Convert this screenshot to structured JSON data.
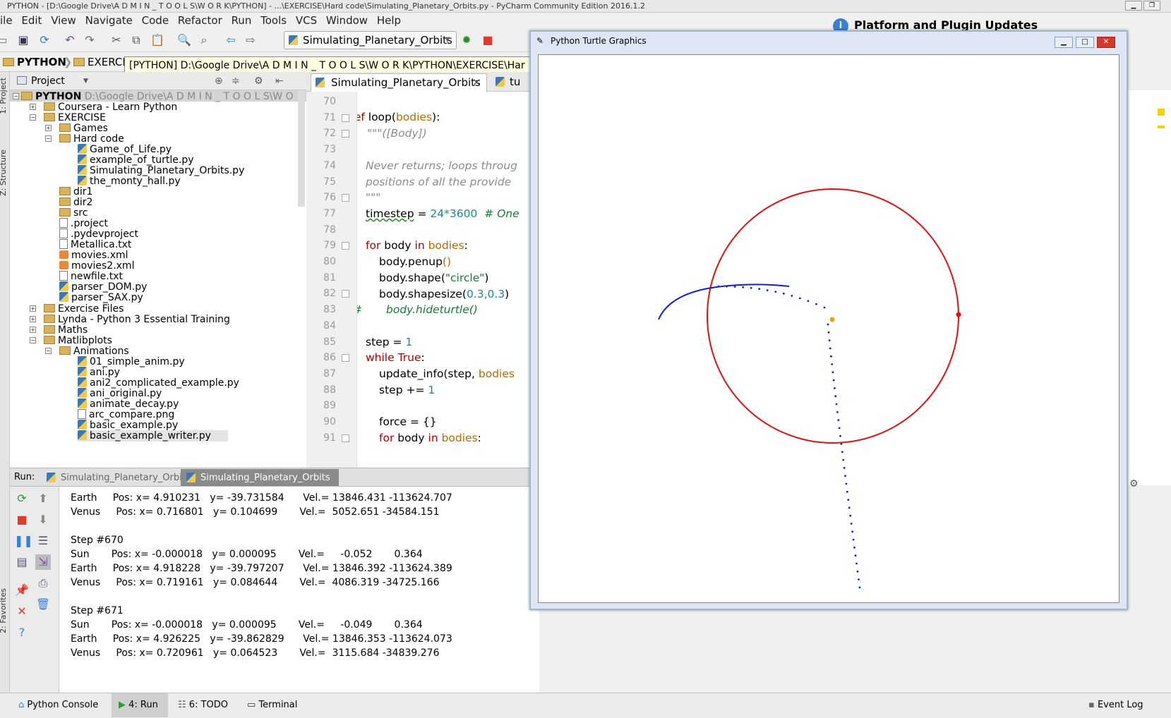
{
  "window": {
    "title": "PYTHON - [D:\\Google Drive\\A D M I N _ T O O L S\\W O R K\\PYTHON] - ...\\EXERCISE\\Hard code\\Simulating_Planetary_Orbits.py - PyCharm Community Edition 2016.1.2"
  },
  "menu": [
    "ile",
    "Edit",
    "View",
    "Navigate",
    "Code",
    "Refactor",
    "Run",
    "Tools",
    "VCS",
    "Window",
    "Help"
  ],
  "toolbar": {
    "run_config": "Simulating_Planetary_Orbits"
  },
  "navbar": {
    "crumb1": "PYTHON",
    "crumb2": "EXERCI"
  },
  "tooltip": "[PYTHON] D:\\Google Drive\\A D M I N _ T O O L S\\W O R K\\PYTHON\\EXERCISE\\Har",
  "side_tabs": {
    "project": "1: Project",
    "structure": "Z: Structure",
    "favorites": "2: Favorites"
  },
  "project": {
    "header": "Project",
    "root_name": "PYTHON",
    "root_path": "D:\\Google Drive\\A D M I N _ T O O L S\\W O",
    "items": [
      "Coursera - Learn Python",
      "EXERCISE",
      "Games",
      "Hard code",
      "Game_of_Life.py",
      "example_of_turtle.py",
      "Simulating_Planetary_Orbits.py",
      "the_monty_hall.py",
      "dir1",
      "dir2",
      "src",
      ".project",
      ".pydevproject",
      "Metallica.txt",
      "movies.xml",
      "movies2.xml",
      "newfile.txt",
      "parser_DOM.py",
      "parser_SAX.py",
      "Exercise Files",
      "Lynda - Python 3 Essential Training",
      "Maths",
      "Matlibplots",
      "Animations",
      "01_simple_anim.py",
      "ani.py",
      "ani2_complicated_example.py",
      "ani_original.py",
      "animate_decay.py",
      "arc_compare.png",
      "basic_example.py",
      "basic_example_writer.py"
    ]
  },
  "editor": {
    "tab1": "Simulating_Planetary_Orbits",
    "tab2": "tu",
    "line_numbers": [
      "70",
      "71",
      "72",
      "73",
      "74",
      "75",
      "76",
      "77",
      "78",
      "79",
      "80",
      "81",
      "82",
      "83",
      "84",
      "85",
      "86",
      "87",
      "88",
      "89",
      "90",
      "91"
    ],
    "code": {
      "l71_kw": "def ",
      "l71_fn": "loop",
      "l71_p1": "(",
      "l71_pm": "bodies",
      "l71_p2": "):",
      "l72": "\"\"\"([Body])",
      "l74": "Never returns; loops throug",
      "l75": "positions of all the provide",
      "l76": "\"\"\"",
      "l77_a": "timestep",
      "l77_b": " = ",
      "l77_n": "24*3600",
      "l77_c": "  # One",
      "l79_kw": "for",
      "l79_b": " body ",
      "l79_kw2": "in",
      "l79_pm": " bodies",
      "l79_c": ":",
      "l80_a": "body.penup",
      "l80_b": "()",
      "l81_a": "body.shape(",
      "l81_s": "\"circle\"",
      "l81_b": ")",
      "l82_a": "body.shapesize(",
      "l82_n": "0.3,0.3",
      "l82_b": ")",
      "l83_h": "#",
      "l83_c": "body.hideturtle()",
      "l85_a": "step",
      "l85_b": " = ",
      "l85_n": "1",
      "l86_kw": "while",
      "l86_kw2": " True",
      "l86_c": ":",
      "l87_a": "update_info(step, ",
      "l87_pm": "bodies",
      "l88_a": "step += ",
      "l88_n": "1",
      "l90_a": "force = {}",
      "l91_kw": "for",
      "l91_b": " body ",
      "l91_kw2": "in",
      "l91_pm": " bodies",
      "l91_c": ":"
    }
  },
  "run": {
    "label": "Run:",
    "tab1": "Simulating_Planetary_Orbits",
    "tab2": "Simulating_Planetary_Orbits",
    "output": [
      "Earth     Pos: x= 4.910231   y= -39.731584      Vel.= 13846.431 -113624.707",
      "Venus     Pos: x= 0.716801   y= 0.104699       Vel.=  5052.651 -34584.151",
      "",
      "Step #670",
      "Sun       Pos: x= -0.000018   y= 0.000095       Vel.=     -0.052       0.364",
      "Earth     Pos: x= 4.918228   y= -39.797207      Vel.= 13846.392 -113624.389",
      "Venus     Pos: x= 0.719161   y= 0.084644       Vel.=  4086.319 -34725.166",
      "",
      "Step #671",
      "Sun       Pos: x= -0.000018   y= 0.000095       Vel.=     -0.049       0.364",
      "Earth     Pos: x= 4.926225   y= -39.862829      Vel.= 13846.353 -113624.073",
      "Venus     Pos: x= 0.720961   y= 0.064523       Vel.=  3115.684 -34839.276"
    ]
  },
  "right": {
    "platform_title": "Platform and Plugin Updates"
  },
  "turtle": {
    "title": "Python Turtle Graphics",
    "colors": {
      "earth_orbit": "#e01010",
      "venus_trail": "#1020d0",
      "sun": "#f0a000"
    }
  },
  "statusbar": {
    "python_console": "Python Console",
    "run": "4: Run",
    "todo": "6: TODO",
    "terminal": "Terminal",
    "event_log": "Event Log"
  }
}
